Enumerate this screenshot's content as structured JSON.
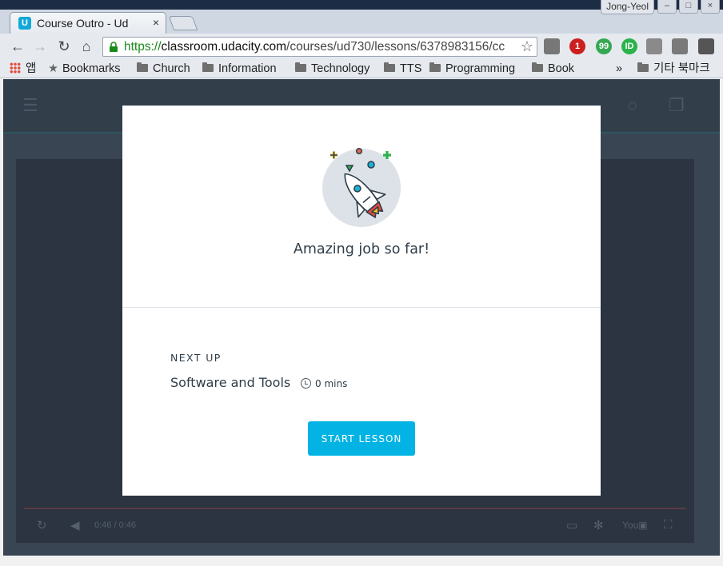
{
  "browser": {
    "tab_title": "Course Outro - Ud",
    "tab_favicon_letter": "U",
    "tab_close": "×",
    "user_badge": "Jong-Yeol",
    "url": {
      "scheme": "https://",
      "host": "classroom.udacity.com",
      "path": "/courses/ud730/lessons/6378983156/cc"
    },
    "nav_icons": [
      "back-arrow-icon",
      "forward-arrow-icon",
      "reload-icon",
      "home-icon"
    ],
    "extensions": [
      {
        "name": "magnifier-icon",
        "label": "",
        "color": "#777777"
      },
      {
        "name": "adblock-icon",
        "label": "1",
        "color": "#cc1f1f"
      },
      {
        "name": "quote-icon",
        "label": "99",
        "color": "#35a852"
      },
      {
        "name": "id-icon",
        "label": "ID",
        "color": "#2bb24c"
      },
      {
        "name": "screenshot-icon",
        "label": "",
        "color": "#8a8a8a"
      },
      {
        "name": "keyboard-icon",
        "label": "",
        "color": "#7a7a7a"
      },
      {
        "name": "chrome-menu-icon",
        "label": "",
        "color": "#555555"
      }
    ]
  },
  "bookmarks": {
    "apps_label": "앱",
    "items": [
      "Bookmarks",
      "Church",
      "Information",
      "Technology",
      "TTS",
      "Programming",
      "Book"
    ],
    "overflow": "»",
    "other_bookmarks": "기타 북마크"
  },
  "video": {
    "time": "0:46 / 0:46"
  },
  "modal": {
    "headline": "Amazing job so far!",
    "next_label": "NEXT UP",
    "lesson_title": "Software and Tools",
    "duration": "0 mins",
    "start_button": "START LESSON",
    "accent_color": "#02b3e4"
  }
}
